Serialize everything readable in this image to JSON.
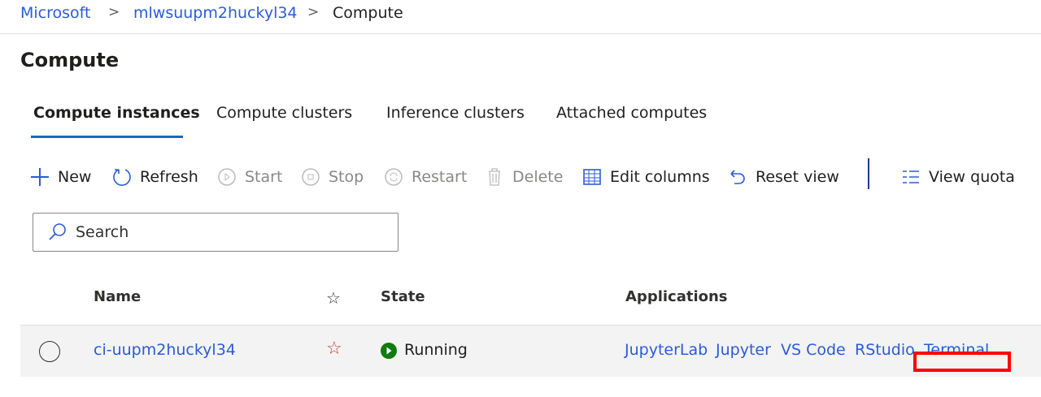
{
  "breadcrumb": [
    "Microsoft",
    "mlwsuupm2huckyl34",
    "Compute"
  ],
  "page_title": "Compute",
  "tabs": [
    {
      "label": "Compute instances",
      "active": true
    },
    {
      "label": "Compute clusters"
    },
    {
      "label": "Inference clusters"
    },
    {
      "label": "Attached computes"
    }
  ],
  "toolbar": {
    "new": "New",
    "refresh": "Refresh",
    "start": "Start",
    "stop": "Stop",
    "restart": "Restart",
    "delete": "Delete",
    "edit_columns": "Edit columns",
    "reset_view": "Reset view",
    "view_quota": "View quota"
  },
  "search": {
    "placeholder": "Search"
  },
  "table": {
    "headers": {
      "name": "Name",
      "state": "State",
      "applications": "Applications"
    },
    "rows": [
      {
        "name": "ci-uupm2huckyl34",
        "state": "Running",
        "apps": [
          "JupyterLab",
          "Jupyter",
          "VS Code",
          "RStudio",
          "Terminal"
        ]
      }
    ]
  },
  "colors": {
    "accent": "#0f6cbd",
    "link": "#2b5bd7",
    "running": "#107c10",
    "highlight": "#ff0000",
    "favorite": "#d13438"
  }
}
